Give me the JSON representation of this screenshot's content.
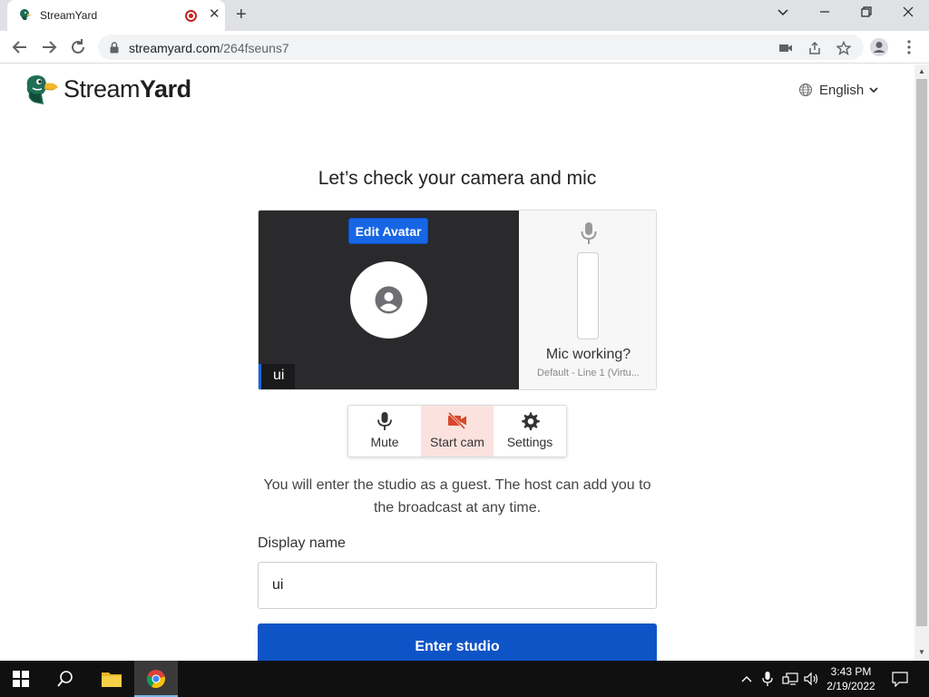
{
  "browser": {
    "tab_title": "StreamYard",
    "url_host": "streamyard.com",
    "url_path": "/264fseuns7"
  },
  "page": {
    "logo_word1": "Stream",
    "logo_word2": "Yard",
    "language": "English",
    "heading": "Let’s check your camera and mic",
    "edit_avatar": "Edit Avatar",
    "name_tag": "ui",
    "mic_working": "Mic working?",
    "mic_device": "Default - Line 1 (Virtu...",
    "controls": {
      "mute": "Mute",
      "start_cam": "Start cam",
      "settings": "Settings"
    },
    "guest_text": "You will enter the studio as a guest. The host can add you to the broadcast at any time.",
    "display_name_label": "Display name",
    "display_name_value": "ui",
    "enter_button": "Enter studio"
  },
  "taskbar": {
    "time": "3:43 PM",
    "date": "2/19/2022"
  },
  "colors": {
    "primary_blue": "#0f54c6",
    "edit_avatar_blue": "#1766e5",
    "cam_off_red": "#d9472b",
    "start_cam_bg": "#fbe2de"
  }
}
